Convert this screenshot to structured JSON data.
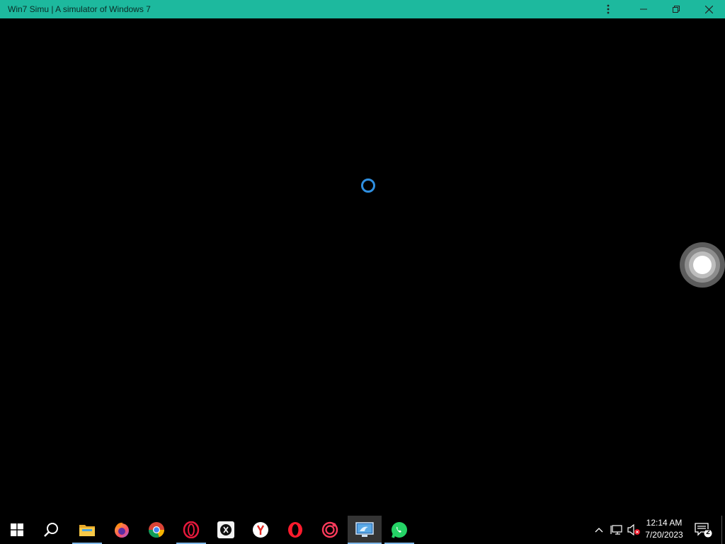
{
  "window": {
    "title": "Win7 Simu | A simulator of Windows 7",
    "accent_color": "#1db99e"
  },
  "content": {
    "background": "#000000",
    "loading_indicator": "spinner-icon"
  },
  "taskbar": {
    "apps": [
      {
        "name": "start",
        "icon": "windows-logo-icon"
      },
      {
        "name": "search",
        "icon": "search-icon"
      },
      {
        "name": "file-explorer",
        "icon": "folder-icon"
      },
      {
        "name": "firefox",
        "icon": "firefox-icon"
      },
      {
        "name": "chrome",
        "icon": "chrome-icon"
      },
      {
        "name": "opera-gx",
        "icon": "opera-gx-icon"
      },
      {
        "name": "app-x",
        "icon": "x-app-icon"
      },
      {
        "name": "yandex",
        "icon": "yandex-icon"
      },
      {
        "name": "opera",
        "icon": "opera-icon"
      },
      {
        "name": "app-circle",
        "icon": "ring-app-icon"
      },
      {
        "name": "win7-simu",
        "icon": "win7-simu-icon"
      },
      {
        "name": "whatsapp",
        "icon": "whatsapp-icon"
      }
    ],
    "tray": {
      "time": "12:14 AM",
      "date": "7/20/2023",
      "notification_count": "2"
    }
  }
}
